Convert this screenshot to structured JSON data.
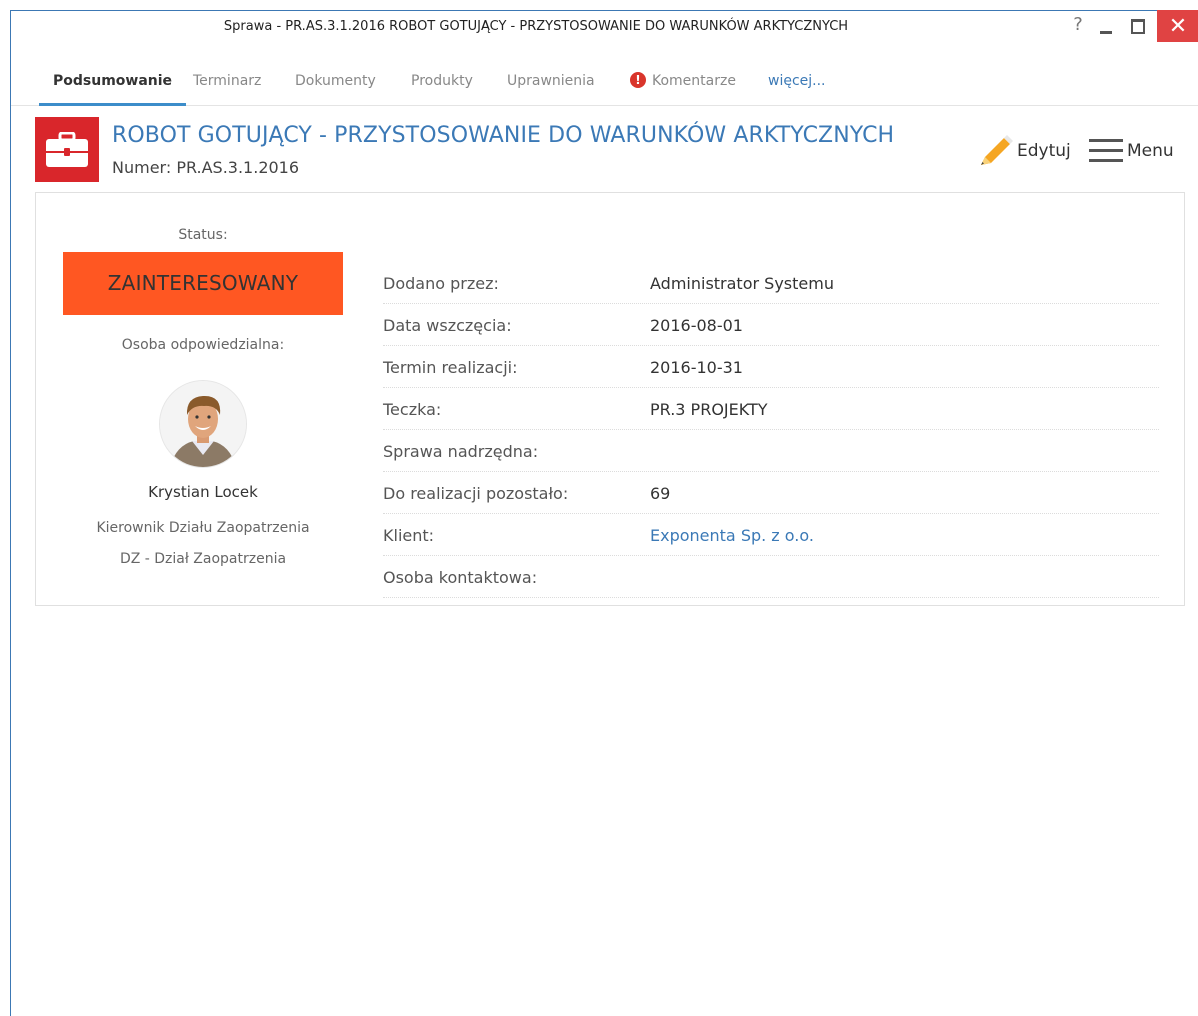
{
  "window": {
    "title": "Sprawa - PR.AS.3.1.2016 ROBOT GOTUJĄCY - PRZYSTOSOWANIE DO WARUNKÓW ARKTYCZNYCH",
    "help": "?",
    "close": "✕"
  },
  "tabs": [
    {
      "label": "Podsumowanie"
    },
    {
      "label": "Terminarz"
    },
    {
      "label": "Dokumenty"
    },
    {
      "label": "Produkty"
    },
    {
      "label": "Uprawnienia"
    },
    {
      "label": "Komentarze",
      "alert": "!"
    },
    {
      "label": "więcej..."
    }
  ],
  "header": {
    "title": "ROBOT GOTUJĄCY - PRZYSTOSOWANIE DO WARUNKÓW ARKTYCZNYCH",
    "number": "Numer: PR.AS.3.1.2016",
    "edit_label": "Edytuj",
    "menu_label": "Menu",
    "icon": "briefcase-icon",
    "icon_color": "#d9262b"
  },
  "summary": {
    "status_label": "Status:",
    "status_value": "ZAINTERESOWANY",
    "status_color": "#ff5722",
    "responsible_label": "Osoba odpowiedzialna:",
    "person_name": "Krystian Locek",
    "person_role": "Kierownik Działu Zaopatrzenia",
    "person_dept": "DZ - Dział Zaopatrzenia"
  },
  "details": [
    {
      "label": "Dodano przez:",
      "value": "Administrator Systemu"
    },
    {
      "label": "Data wszczęcia:",
      "value": "2016-08-01"
    },
    {
      "label": "Termin realizacji:",
      "value": "2016-10-31"
    },
    {
      "label": "Teczka:",
      "value": "PR.3 PROJEKTY"
    },
    {
      "label": "Sprawa nadrzędna:",
      "value": ""
    },
    {
      "label": "Do realizacji pozostało:",
      "value": "69"
    },
    {
      "label": "Klient:",
      "value": "Exponenta Sp. z o.o."
    },
    {
      "label": "Osoba kontaktowa:",
      "value": ""
    }
  ]
}
